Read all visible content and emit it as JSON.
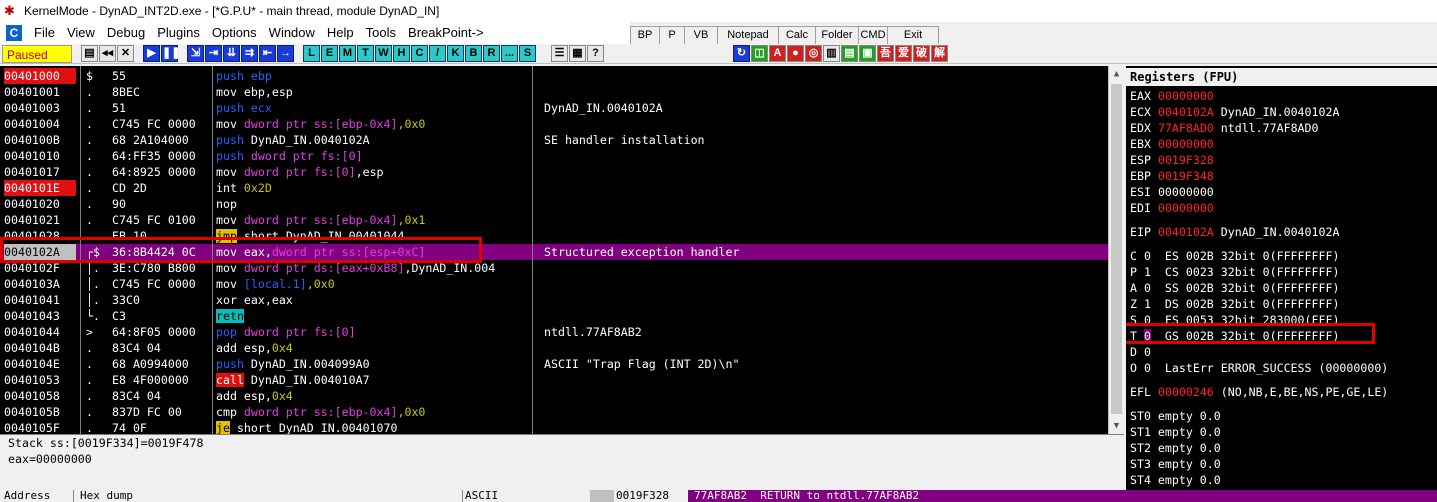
{
  "window": {
    "title": "KernelMode - DynAD_INT2D.exe - [*G.P.U* - main thread, module DynAD_IN]"
  },
  "menu": [
    "File",
    "View",
    "Debug",
    "Plugins",
    "Options",
    "Window",
    "Help",
    "Tools",
    "BreakPoint->"
  ],
  "top_buttons": [
    "BP",
    "P",
    "VB",
    "Notepad",
    "Calc",
    "Folder",
    "CMD",
    "Exit"
  ],
  "toolbar": {
    "status": "Paused",
    "letters": [
      "L",
      "E",
      "M",
      "T",
      "W",
      "H",
      "C",
      "/",
      "K",
      "B",
      "R",
      "...",
      "S"
    ]
  },
  "disasm": [
    {
      "addr": "00401000",
      "bp": true,
      "mark": "$",
      "hex": "55",
      "ins": [
        {
          "t": "push ebp",
          "c": "blue"
        }
      ],
      "cmt": ""
    },
    {
      "addr": "00401001",
      "mark": ".",
      "hex": "8BEC",
      "ins": [
        {
          "t": "mov ebp,esp"
        }
      ],
      "cmt": ""
    },
    {
      "addr": "00401003",
      "mark": ".",
      "hex": "51",
      "ins": [
        {
          "t": "push ecx",
          "c": "blue"
        }
      ],
      "cmt": "DynAD_IN.0040102A"
    },
    {
      "addr": "00401004",
      "mark": ".",
      "hex": "C745 FC 0000",
      "ins": [
        {
          "t": "mov "
        },
        {
          "t": "dword ptr ss:[ebp-0x4]",
          "c": "mag"
        },
        {
          "t": ",0x0",
          "c": "imm"
        }
      ],
      "cmt": ""
    },
    {
      "addr": "0040100B",
      "mark": ".",
      "hex": "68 2A104000",
      "ins": [
        {
          "t": "push ",
          "c": "blue"
        },
        {
          "t": "DynAD_IN.0040102A"
        }
      ],
      "cmt": "SE handler installation"
    },
    {
      "addr": "00401010",
      "mark": ".",
      "hex": "64:FF35 0000",
      "ins": [
        {
          "t": "push ",
          "c": "blue"
        },
        {
          "t": "dword ptr fs:[0]",
          "c": "mag"
        }
      ],
      "cmt": ""
    },
    {
      "addr": "00401017",
      "mark": ".",
      "hex": "64:8925 0000",
      "ins": [
        {
          "t": "mov "
        },
        {
          "t": "dword ptr fs:[0]",
          "c": "mag"
        },
        {
          "t": ",esp"
        }
      ],
      "cmt": ""
    },
    {
      "addr": "0040101E",
      "bp": true,
      "mark": ".",
      "hex": "CD 2D",
      "ins": [
        {
          "t": "int "
        },
        {
          "t": "0x2D",
          "c": "imm"
        }
      ],
      "cmt": ""
    },
    {
      "addr": "00401020",
      "mark": ".",
      "hex": "90",
      "ins": [
        {
          "t": "nop"
        }
      ],
      "cmt": ""
    },
    {
      "addr": "00401021",
      "mark": ".",
      "hex": "C745 FC 0100",
      "ins": [
        {
          "t": "mov "
        },
        {
          "t": "dword ptr ss:[ebp-0x4]",
          "c": "mag"
        },
        {
          "t": ",0x1",
          "c": "imm"
        }
      ],
      "cmt": ""
    },
    {
      "addr": "00401028",
      "mark": ".",
      "hex": "EB 10",
      "ins": [
        {
          "t": "jmp",
          "c": "yel"
        },
        {
          "t": " short DynAD_IN.00401044"
        }
      ],
      "cmt": ""
    },
    {
      "addr": "0040102A",
      "sel": true,
      "mark": "┌$",
      "hex": "36:8B4424 0C",
      "ins": [
        {
          "t": "mov eax,"
        },
        {
          "t": "dword ptr ss:[esp+0xC]",
          "c": "mag"
        }
      ],
      "cmt": "Structured exception handler"
    },
    {
      "addr": "0040102F",
      "mark": "│.",
      "hex": "3E:C780 B800",
      "ins": [
        {
          "t": "mov "
        },
        {
          "t": "dword ptr ds:[eax+0xB8]",
          "c": "mag"
        },
        {
          "t": ",DynAD_IN.004"
        }
      ],
      "cmt": ""
    },
    {
      "addr": "0040103A",
      "mark": "│.",
      "hex": "C745 FC 0000",
      "ins": [
        {
          "t": "mov "
        },
        {
          "t": "[local.1]",
          "c": "blue"
        },
        {
          "t": ",0x0",
          "c": "imm"
        }
      ],
      "cmt": ""
    },
    {
      "addr": "00401041",
      "mark": "│.",
      "hex": "33C0",
      "ins": [
        {
          "t": "xor eax,eax"
        }
      ],
      "cmt": ""
    },
    {
      "addr": "00401043",
      "mark": "└.",
      "hex": "C3",
      "ins": [
        {
          "t": "retn",
          "c": "cyan"
        }
      ],
      "cmt": ""
    },
    {
      "addr": "00401044",
      "mark": ">",
      "hex": "64:8F05 0000",
      "ins": [
        {
          "t": "pop ",
          "c": "blue"
        },
        {
          "t": "dword ptr fs:[0]",
          "c": "mag"
        }
      ],
      "cmt": "ntdll.77AF8AB2"
    },
    {
      "addr": "0040104B",
      "mark": ".",
      "hex": "83C4 04",
      "ins": [
        {
          "t": "add esp,"
        },
        {
          "t": "0x4",
          "c": "imm"
        }
      ],
      "cmt": ""
    },
    {
      "addr": "0040104E",
      "mark": ".",
      "hex": "68 A0994000",
      "ins": [
        {
          "t": "push ",
          "c": "blue"
        },
        {
          "t": "DynAD_IN.004099A0"
        }
      ],
      "cmt": "ASCII \"Trap Flag (INT 2D)\\n\""
    },
    {
      "addr": "00401053",
      "mark": ".",
      "hex": "E8 4F000000",
      "ins": [
        {
          "t": "call",
          "c": "red"
        },
        {
          "t": " DynAD_IN.004010A7"
        }
      ],
      "cmt": ""
    },
    {
      "addr": "00401058",
      "mark": ".",
      "hex": "83C4 04",
      "ins": [
        {
          "t": "add esp,"
        },
        {
          "t": "0x4",
          "c": "imm"
        }
      ],
      "cmt": ""
    },
    {
      "addr": "0040105B",
      "mark": ".",
      "hex": "837D FC 00",
      "ins": [
        {
          "t": "cmp "
        },
        {
          "t": "dword ptr ss:[ebp-0x4]",
          "c": "mag"
        },
        {
          "t": ",0x0",
          "c": "imm"
        }
      ],
      "cmt": ""
    },
    {
      "addr": "0040105F",
      "mark": ".",
      "hex": "74 0F",
      "ins": [
        {
          "t": "je",
          "c": "yel"
        },
        {
          "t": " short DynAD_IN.00401070"
        }
      ],
      "cmt": ""
    }
  ],
  "info": {
    "line1": "Stack ss:[0019F334]=0019F478",
    "line2": "eax=00000000"
  },
  "registers": {
    "title": "Registers (FPU)",
    "gp": [
      {
        "n": "EAX",
        "v": "00000000",
        "red": true,
        "note": ""
      },
      {
        "n": "ECX",
        "v": "0040102A",
        "red": true,
        "note": "DynAD_IN.0040102A"
      },
      {
        "n": "EDX",
        "v": "77AF8AD0",
        "red": true,
        "note": "ntdll.77AF8AD0"
      },
      {
        "n": "EBX",
        "v": "00000000",
        "red": true,
        "note": ""
      },
      {
        "n": "ESP",
        "v": "0019F328",
        "red": true,
        "note": ""
      },
      {
        "n": "EBP",
        "v": "0019F348",
        "red": true,
        "note": ""
      },
      {
        "n": "ESI",
        "v": "00000000",
        "red": false,
        "note": ""
      },
      {
        "n": "EDI",
        "v": "00000000",
        "red": true,
        "note": ""
      }
    ],
    "eip": {
      "n": "EIP",
      "v": "0040102A",
      "note": "DynAD_IN.0040102A"
    },
    "flags": [
      {
        "f": "C",
        "b": "0",
        "seg": "ES 002B 32bit 0(FFFFFFFF)"
      },
      {
        "f": "P",
        "b": "1",
        "seg": "CS 0023 32bit 0(FFFFFFFF)"
      },
      {
        "f": "A",
        "b": "0",
        "seg": "SS 002B 32bit 0(FFFFFFFF)"
      },
      {
        "f": "Z",
        "b": "1",
        "seg": "DS 002B 32bit 0(FFFFFFFF)"
      },
      {
        "f": "S",
        "b": "0",
        "seg": "FS 0053 32bit 283000(FFF)"
      },
      {
        "f": "T",
        "b": "0",
        "seg": "GS 002B 32bit 0(FFFFFFFF)"
      },
      {
        "f": "D",
        "b": "0",
        "seg": ""
      },
      {
        "f": "O",
        "b": "0",
        "seg": "LastErr ERROR_SUCCESS (00000000)"
      }
    ],
    "efl": {
      "n": "EFL",
      "v": "00000246",
      "note": "(NO,NB,E,BE,NS,PE,GE,LE)"
    },
    "fpu": [
      "ST0 empty 0.0",
      "ST1 empty 0.0",
      "ST2 empty 0.0",
      "ST3 empty 0.0",
      "ST4 empty 0.0"
    ]
  },
  "bottom": {
    "address": "Address",
    "hexdump": "Hex dump",
    "ascii": "ASCII",
    "stack_addr": "0019F328",
    "stack_val": "77AF8AB2",
    "stack_cmt": "RETURN to ntdll.77AF8AB2"
  }
}
